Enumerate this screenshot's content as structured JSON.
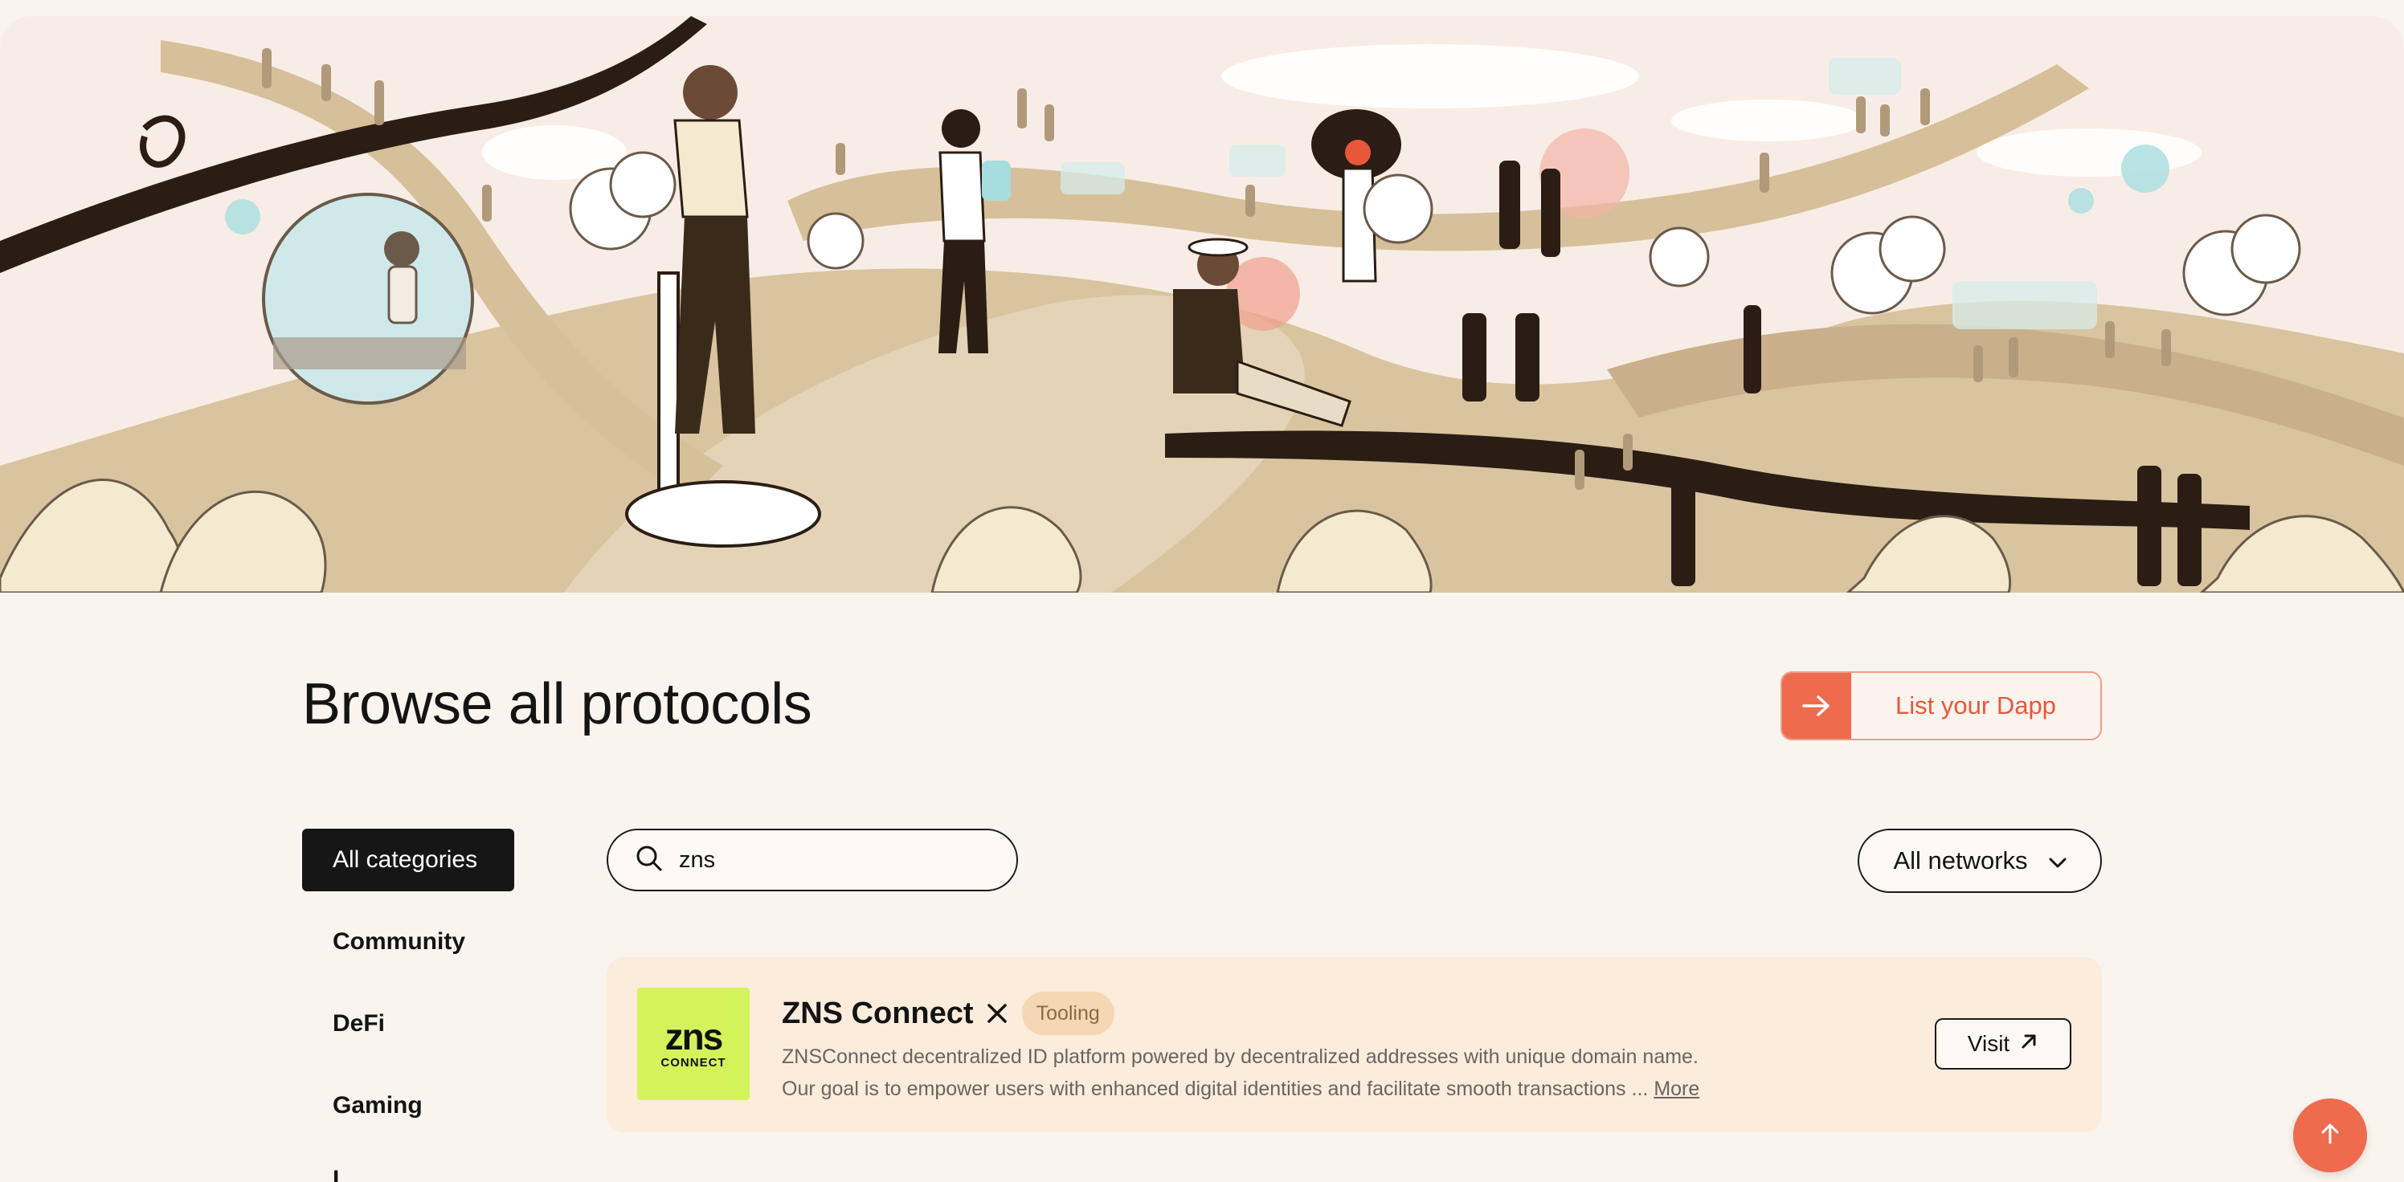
{
  "hero": {
    "illustration": "winding-paths-people-illustration",
    "colors": {
      "background": "#f8ede6",
      "path": "#d6c09a",
      "dark_ribbon": "#2b1d14",
      "accent": "#f1a08c",
      "bubble": "#a8dde0"
    }
  },
  "page": {
    "title": "Browse all protocols"
  },
  "list_dapp": {
    "label": "List your Dapp",
    "icon": "arrow-right-icon"
  },
  "categories": [
    {
      "label": "All categories",
      "active": true
    },
    {
      "label": "Community",
      "active": false
    },
    {
      "label": "DeFi",
      "active": false
    },
    {
      "label": "Gaming",
      "active": false
    }
  ],
  "search": {
    "value": "zns",
    "icon": "search-icon"
  },
  "networks": {
    "label": "All networks",
    "icon": "chevron-down-icon"
  },
  "results": [
    {
      "logo_text_big": "zns",
      "logo_text_small": "CONNECT",
      "name": "ZNS Connect",
      "tag": "Tooling",
      "description_line1": "ZNSConnect decentralized ID platform powered by decentralized addresses with unique domain name.",
      "description_line2": "Our goal is to empower users with enhanced digital identities and facilitate smooth transactions ...",
      "more_label": "More",
      "visit_label": "Visit",
      "social_icon": "x-logo-icon"
    }
  ],
  "scroll_top": {
    "icon": "arrow-up-icon"
  },
  "colors": {
    "accent": "#ee6b4d",
    "accent_text": "#e8573a",
    "page_bg": "#faf4ee",
    "card_bg": "#fbecdc",
    "tag_bg": "#f6d7b4",
    "logo_bg": "#d4f35b"
  }
}
